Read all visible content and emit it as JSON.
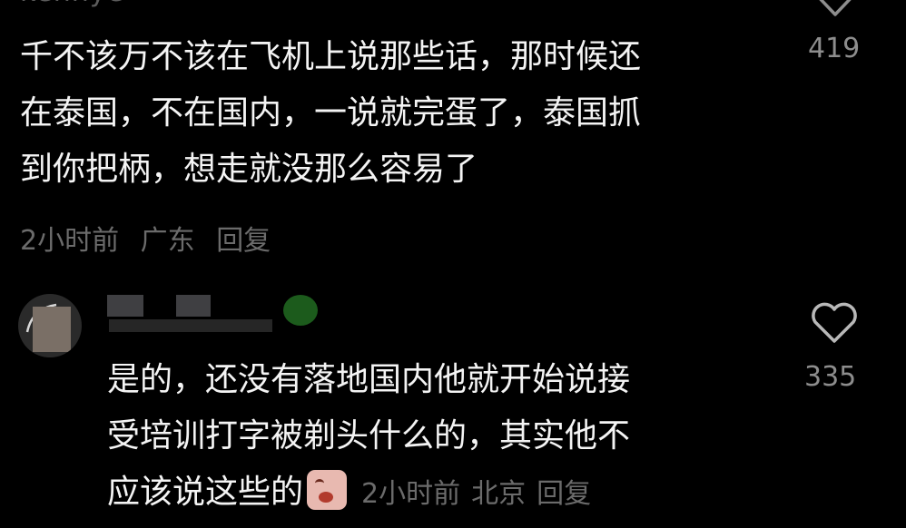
{
  "comment1": {
    "username": "kenhye",
    "lines": [
      "千不该万不该在飞机上说那些话，那时候还",
      "在泰国，不在国内，一说就完蛋了，泰国抓",
      "到你把柄，想走就没那么容易了"
    ],
    "likes": "419",
    "time": "2小时前",
    "location": "广东",
    "reply_label": "回复"
  },
  "comment2": {
    "lines": [
      "是的，还没有落地国内他就开始说接",
      "受培训打字被剃头什么的，其实他不",
      "应该说这些的"
    ],
    "likes": "335",
    "time": "2小时前",
    "location": "北京",
    "reply_label": "回复",
    "emoji_icon": "crying-face-sticker"
  }
}
